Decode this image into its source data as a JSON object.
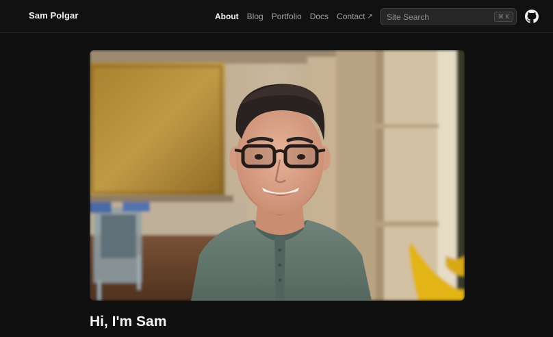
{
  "site": {
    "brand": "Sam Polgar"
  },
  "nav": {
    "items": [
      {
        "label": "About",
        "active": true
      },
      {
        "label": "Blog",
        "active": false
      },
      {
        "label": "Portfolio",
        "active": false
      },
      {
        "label": "Docs",
        "active": false
      },
      {
        "label": "Contact",
        "active": false,
        "external": true
      }
    ],
    "external_arrow": "↗"
  },
  "search": {
    "placeholder": "Site Search",
    "shortcut_symbol": "⌘",
    "shortcut_key": "K"
  },
  "icons": {
    "github": "github-icon",
    "search_shortcut": "command-icon"
  },
  "hero": {
    "image_subject": "portrait-photo"
  },
  "main": {
    "heading": "Hi, I'm Sam"
  },
  "colors": {
    "background": "#101010",
    "text_primary": "#f4f4f4",
    "text_muted": "#a3a3a3"
  }
}
